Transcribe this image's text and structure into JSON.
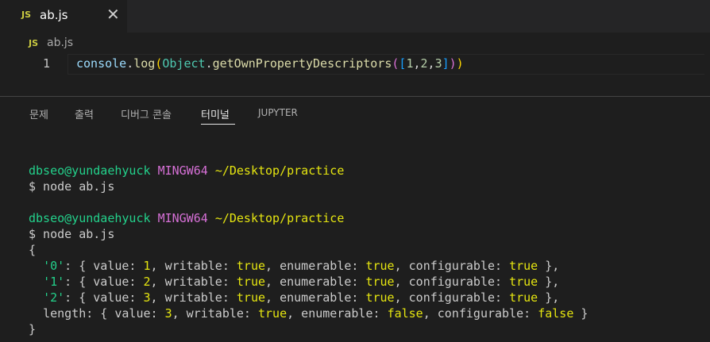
{
  "tabs": [
    {
      "icon": "JS",
      "label": "ab.js",
      "close": "✕"
    }
  ],
  "breadcrumb": {
    "icon": "JS",
    "file": "ab.js"
  },
  "editor": {
    "line_number": "1",
    "code": {
      "obj": "console",
      "dot1": ".",
      "method": "log",
      "paren_open": "(",
      "class": "Object",
      "dot2": ".",
      "fn": "getOwnPropertyDescriptors",
      "paren2_open": "(",
      "bracket_open": "[",
      "n1": "1",
      "comma1": ",",
      "n2": "2",
      "comma2": ",",
      "n3": "3",
      "bracket_close": "]",
      "paren2_close": ")",
      "paren_close": ")"
    }
  },
  "panel": {
    "tabs": [
      "문제",
      "출력",
      "디버그 콘솔",
      "터미널",
      "JUPYTER"
    ],
    "active": "터미널"
  },
  "terminal": {
    "prompt1": {
      "user": "dbseo@yundaehyuck",
      "env": "MINGW64",
      "path": "~/Desktop/practice"
    },
    "cmd1": "$ node ab.js",
    "prompt2": {
      "user": "dbseo@yundaehyuck",
      "env": "MINGW64",
      "path": "~/Desktop/practice"
    },
    "cmd2": "$ node ab.js",
    "open_brace": "{",
    "rows": [
      {
        "key": "'0'",
        "value": "1",
        "writable": "true",
        "enumerable": "true",
        "configurable": "true",
        "end": " },"
      },
      {
        "key": "'1'",
        "value": "2",
        "writable": "true",
        "enumerable": "true",
        "configurable": "true",
        "end": " },"
      },
      {
        "key": "'2'",
        "value": "3",
        "writable": "true",
        "enumerable": "true",
        "configurable": "true",
        "end": " },"
      },
      {
        "key": "length",
        "value": "3",
        "writable": "true",
        "enumerable": "false",
        "configurable": "false",
        "end": " }"
      }
    ],
    "labels": {
      "value": "value: ",
      "writable": ", writable: ",
      "enumerable": ", enumerable: ",
      "configurable": ", configurable: "
    },
    "close_brace": "}"
  },
  "colors": {
    "background": "#1e1e1e",
    "tabbar": "#252526",
    "js_icon": "#cbcb41",
    "prompt_user": "#23d18b",
    "prompt_env": "#d670d6",
    "prompt_path": "#e5e510"
  }
}
